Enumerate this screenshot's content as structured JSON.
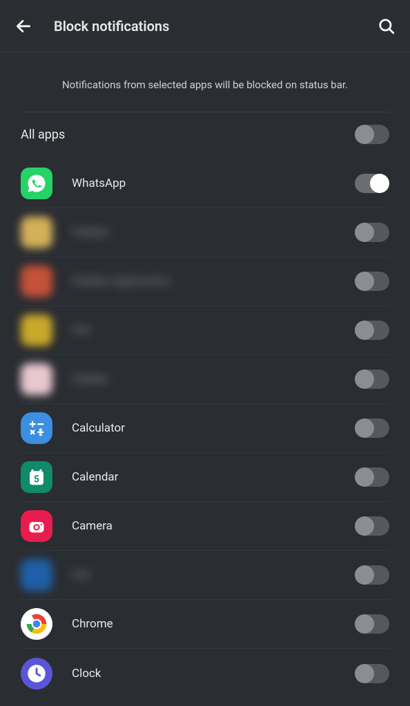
{
  "header": {
    "title": "Block notifications"
  },
  "description": "Notifications from selected apps will be blocked on status bar.",
  "allApps": {
    "label": "All apps",
    "enabled": false
  },
  "apps": [
    {
      "name": "WhatsApp",
      "icon": "whatsapp",
      "enabled": true,
      "blurred": false
    },
    {
      "name": "Hidden",
      "icon": "blur1",
      "enabled": false,
      "blurred": true
    },
    {
      "name": "Hidden Application",
      "icon": "blur2",
      "enabled": false,
      "blurred": true
    },
    {
      "name": "Hid",
      "icon": "blur3",
      "enabled": false,
      "blurred": true
    },
    {
      "name": "Hidden",
      "icon": "blur4",
      "enabled": false,
      "blurred": true
    },
    {
      "name": "Calculator",
      "icon": "calculator",
      "enabled": false,
      "blurred": false
    },
    {
      "name": "Calendar",
      "icon": "calendar",
      "enabled": false,
      "blurred": false
    },
    {
      "name": "Camera",
      "icon": "camera",
      "enabled": false,
      "blurred": false
    },
    {
      "name": "Hid",
      "icon": "blur5",
      "enabled": false,
      "blurred": true
    },
    {
      "name": "Chrome",
      "icon": "chrome",
      "enabled": false,
      "blurred": false
    },
    {
      "name": "Clock",
      "icon": "clock",
      "enabled": false,
      "blurred": false
    }
  ]
}
